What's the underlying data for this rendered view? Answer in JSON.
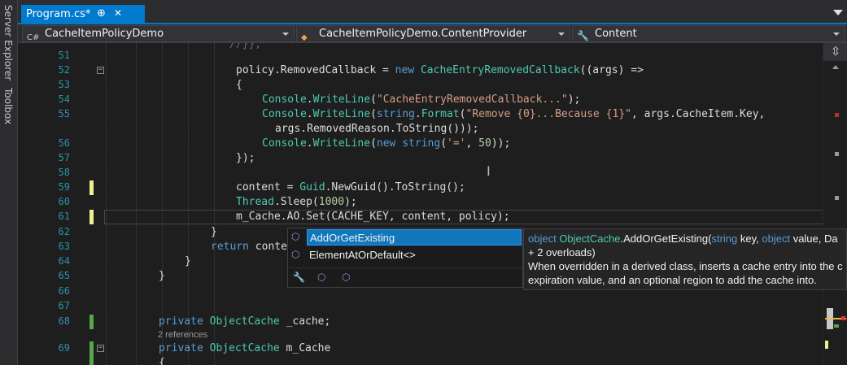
{
  "side_tabs": [
    "Server Explorer",
    "Toolbox"
  ],
  "tab": {
    "title": "Program.cs*",
    "pin": "⊕",
    "close": "✕"
  },
  "navbar": {
    "project": "CacheItemPolicyDemo",
    "class": "CacheItemPolicyDemo.ContentProvider",
    "member": "Content"
  },
  "editor": {
    "top_fragment": "//}};",
    "lines": [
      {
        "n": "51",
        "code": []
      },
      {
        "n": "52",
        "code": [
          [
            "tx",
            "policy.RemovedCallback = "
          ],
          [
            "kw",
            "new "
          ],
          [
            "ty",
            "CacheEntryRemovedCallback"
          ],
          [
            "tx",
            "((args) =>"
          ]
        ]
      },
      {
        "n": "53",
        "code": [
          [
            "tx",
            "{"
          ]
        ]
      },
      {
        "n": "54",
        "code": [
          [
            "ty",
            "Console"
          ],
          [
            "tx",
            "."
          ],
          [
            "ty",
            "WriteLine"
          ],
          [
            "tx",
            "("
          ],
          [
            "st",
            "\"CacheEntryRemovedCallback...\""
          ],
          [
            "tx",
            ");"
          ]
        ]
      },
      {
        "n": "55",
        "code": [
          [
            "ty",
            "Console"
          ],
          [
            "tx",
            "."
          ],
          [
            "ty",
            "WriteLine"
          ],
          [
            "tx",
            "("
          ],
          [
            "kw",
            "string"
          ],
          [
            "tx",
            "."
          ],
          [
            "ty",
            "Format"
          ],
          [
            "tx",
            "("
          ],
          [
            "st",
            "\"Remove {0}...Because {1}\""
          ],
          [
            "tx",
            ", args.CacheItem.Key,"
          ]
        ]
      },
      {
        "n": "",
        "code": [
          [
            "tx",
            "args.RemovedReason.ToString()));"
          ]
        ]
      },
      {
        "n": "56",
        "code": [
          [
            "ty",
            "Console"
          ],
          [
            "tx",
            "."
          ],
          [
            "ty",
            "WriteLine"
          ],
          [
            "tx",
            "("
          ],
          [
            "kw",
            "new "
          ],
          [
            "kw",
            "string"
          ],
          [
            "tx",
            "("
          ],
          [
            "st",
            "'='"
          ],
          [
            "tx",
            ", "
          ],
          [
            "nu",
            "50"
          ],
          [
            "tx",
            "));"
          ]
        ]
      },
      {
        "n": "57",
        "code": [
          [
            "tx",
            "});"
          ]
        ]
      },
      {
        "n": "58",
        "code": []
      },
      {
        "n": "59",
        "code": [
          [
            "tx",
            "content = "
          ],
          [
            "ty",
            "Guid"
          ],
          [
            "tx",
            ".NewGuid().ToString();"
          ]
        ]
      },
      {
        "n": "60",
        "code": [
          [
            "ty",
            "Thread"
          ],
          [
            "tx",
            ".Sleep("
          ],
          [
            "nu",
            "1000"
          ],
          [
            "tx",
            ");"
          ]
        ]
      },
      {
        "n": "61",
        "code": [
          [
            "tx",
            "m_Cache.AO.Set(CACHE_KEY, content, policy);"
          ]
        ]
      },
      {
        "n": "62",
        "code": [
          [
            "tx",
            "}"
          ]
        ]
      },
      {
        "n": "63",
        "code": [
          [
            "kw",
            "return "
          ],
          [
            "tx",
            "conte"
          ]
        ]
      },
      {
        "n": "64",
        "code": [
          [
            "tx",
            "}"
          ]
        ]
      },
      {
        "n": "65",
        "code": [
          [
            "tx",
            "}"
          ]
        ]
      },
      {
        "n": "66",
        "code": []
      },
      {
        "n": "67",
        "code": []
      },
      {
        "n": "68",
        "code": [
          [
            "kw",
            "private "
          ],
          [
            "ty",
            "ObjectCache "
          ],
          [
            "tx",
            "_cache;"
          ]
        ]
      },
      {
        "n": "69",
        "code": [
          [
            "kw",
            "private "
          ],
          [
            "ty",
            "ObjectCache "
          ],
          [
            "tx",
            "m_Cache"
          ]
        ]
      },
      {
        "n": "",
        "code": [
          [
            "tx",
            "{"
          ]
        ]
      }
    ],
    "references": "2 references"
  },
  "completion": {
    "items": [
      {
        "label": "AddOrGetExisting",
        "icon": "method-icon",
        "selected": true
      },
      {
        "label": "ElementAtOrDefault<>",
        "icon": "extension-method-icon",
        "selected": false
      }
    ],
    "toolbar_icons": [
      "wrench-icon",
      "method-filter-icon",
      "extension-filter-icon"
    ]
  },
  "tooltip": {
    "sig_pre": "object ",
    "sig_type": "ObjectCache",
    "sig_method": ".AddOrGetExisting(",
    "sig_p1t": "string",
    "sig_p1": " key, ",
    "sig_p2t": "object",
    "sig_p2": " value, Da",
    "overloads": "+ 2 overloads)",
    "desc1": "When overridden in a derived class, inserts a cache entry into the c",
    "desc2": "expiration value, and an optional region to add the cache into."
  },
  "scrollbar": {
    "splitter": "⇳"
  }
}
